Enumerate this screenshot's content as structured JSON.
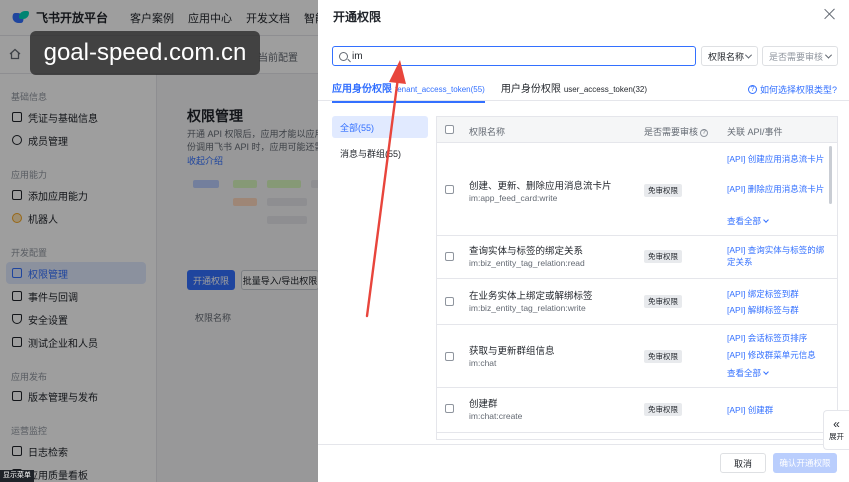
{
  "brand": {
    "name": "飞书开放平台"
  },
  "nav": [
    "客户案例",
    "应用中心",
    "开发文档",
    "智能助"
  ],
  "subbar": {
    "hint": "当前配置"
  },
  "sidebar": {
    "groups": [
      {
        "label": "基础信息",
        "items": [
          "凭证与基础信息",
          "成员管理"
        ]
      },
      {
        "label": "应用能力",
        "items": [
          "添加应用能力",
          "机器人"
        ]
      },
      {
        "label": "开发配置",
        "items": [
          "权限管理",
          "事件与回调",
          "安全设置",
          "测试企业和人员"
        ]
      },
      {
        "label": "应用发布",
        "items": [
          "版本管理与发布"
        ]
      },
      {
        "label": "运营监控",
        "items": [
          "日志检索",
          "应用质量看板"
        ]
      }
    ],
    "active_item": "权限管理"
  },
  "main": {
    "title": "权限管理",
    "desc_line1": "开通 API 权限后，应用才能以应用身份",
    "desc_line2": "份调用飞书 API 时，应用可能还需要",
    "collapse_label": "收起介绍",
    "open_button": "开通权限",
    "batch_button": "批量导入/导出权限",
    "column_label": "权限名称"
  },
  "bottom_tag": "显示菜单",
  "drawer": {
    "title": "开通权限",
    "search": {
      "value": "im",
      "placeholder": ""
    },
    "select_field": "权限名称",
    "select_review": "是否需要审核",
    "tabs": [
      {
        "label": "应用身份权限",
        "sub": "tenant_access_token(55)",
        "active": true
      },
      {
        "label": "用户身份权限",
        "sub": "user_access_token(32)",
        "active": false
      }
    ],
    "help_link": "如何选择权限类型?",
    "categories": [
      {
        "label": "全部(55)",
        "active": true
      },
      {
        "label": "消息与群组(55)",
        "active": false
      }
    ],
    "table": {
      "headers": {
        "name": "权限名称",
        "review": "是否需要审核",
        "api": "关联 API/事件"
      },
      "rows": [
        {
          "name": "创建、更新、删除应用消息流卡片",
          "code": "im:app_feed_card:write",
          "badge": "免审权限",
          "apis": [
            "[API] 创建应用消息流卡片",
            "[API] 删除应用消息流卡片"
          ],
          "more": "查看全部"
        },
        {
          "name": "查询实体与标签的绑定关系",
          "code": "im:biz_entity_tag_relation:read",
          "badge": "免审权限",
          "apis": [
            "[API] 查询实体与标签的绑定关系"
          ],
          "more": ""
        },
        {
          "name": "在业务实体上绑定或解绑标签",
          "code": "im:biz_entity_tag_relation:write",
          "badge": "免审权限",
          "apis": [
            "[API] 绑定标签到群",
            "[API] 解绑标签与群"
          ],
          "more": ""
        },
        {
          "name": "获取与更新群组信息",
          "code": "im:chat",
          "badge": "免审权限",
          "apis": [
            "[API] 会话标签页排序",
            "[API] 修改群菜单元信息"
          ],
          "more": "查看全部"
        },
        {
          "name": "创建群",
          "code": "im:chat:create",
          "badge": "免审权限",
          "apis": [
            "[API] 创建群"
          ],
          "more": ""
        }
      ]
    },
    "footer": {
      "cancel": "取消",
      "confirm": "确认开通权限"
    },
    "expand_label": "展开"
  },
  "watermark": "goal-speed.com.cn",
  "colors": {
    "primary": "#3370ff",
    "annotation_arrow": "#e8453c",
    "confirm_disabled": "#bacefd"
  }
}
